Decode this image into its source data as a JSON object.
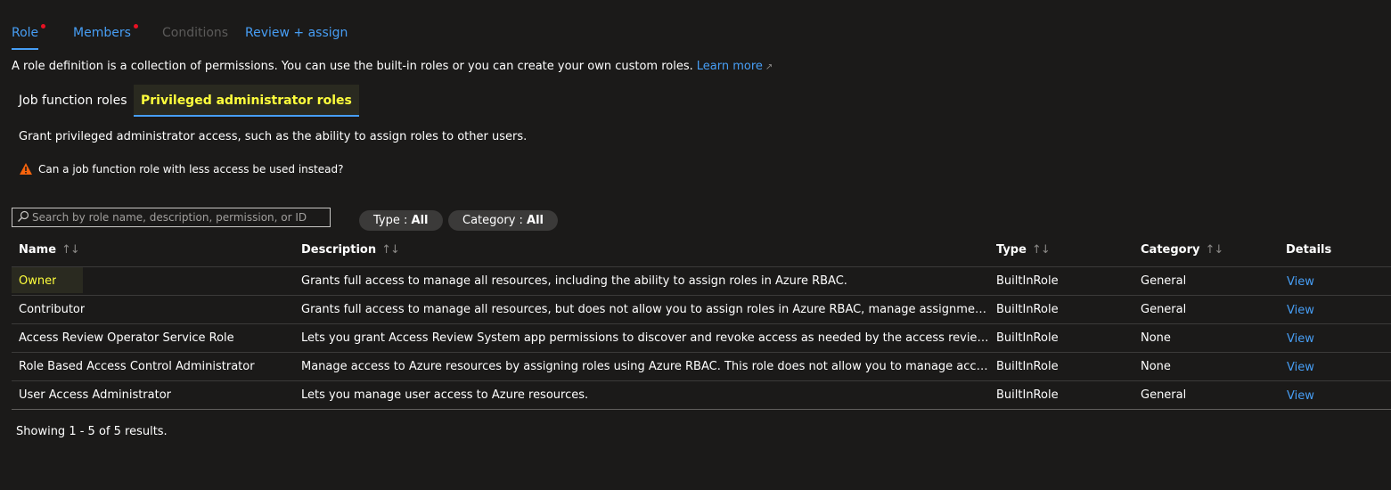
{
  "tabs": [
    {
      "label": "Role",
      "dot": true
    },
    {
      "label": "Members",
      "dot": true
    },
    {
      "label": "Conditions"
    },
    {
      "label": "Review + assign"
    }
  ],
  "intro": {
    "text": "A role definition is a collection of permissions. You can use the built-in roles or you can create your own custom roles.",
    "link": "Learn more",
    "link_icon": "external-link-icon"
  },
  "pivots": {
    "job": "Job function roles",
    "privileged": "Privileged administrator roles"
  },
  "grant_text": "Grant privileged administrator access, such as the ability to assign roles to other users.",
  "warning_text": "Can a job function role with less access be used instead?",
  "search": {
    "placeholder": "Search by role name, description, permission, or ID"
  },
  "filters": {
    "type_label": "Type : ",
    "type_value": "All",
    "category_label": "Category : ",
    "category_value": "All"
  },
  "table": {
    "headers": {
      "name": "Name",
      "description": "Description",
      "type": "Type",
      "category": "Category",
      "details": "Details"
    },
    "sort_icon": "↑↓",
    "rows": [
      {
        "name": "Owner",
        "description": "Grants full access to manage all resources, including the ability to assign roles in Azure RBAC.",
        "type": "BuiltInRole",
        "category": "General",
        "details": "View"
      },
      {
        "name": "Contributor",
        "description": "Grants full access to manage all resources, but does not allow you to assign roles in Azure RBAC, manage assignments in Azure Bluep...",
        "type": "BuiltInRole",
        "category": "General",
        "details": "View"
      },
      {
        "name": "Access Review Operator Service Role",
        "description": "Lets you grant Access Review System app permissions to discover and revoke access as needed by the access review process.",
        "type": "BuiltInRole",
        "category": "None",
        "details": "View"
      },
      {
        "name": "Role Based Access Control Administrator",
        "description": "Manage access to Azure resources by assigning roles using Azure RBAC. This role does not allow you to manage access using other ...",
        "type": "BuiltInRole",
        "category": "None",
        "details": "View"
      },
      {
        "name": "User Access Administrator",
        "description": "Lets you manage user access to Azure resources.",
        "type": "BuiltInRole",
        "category": "General",
        "details": "View"
      }
    ]
  },
  "footer": "Showing 1 - 5 of 5 results.",
  "colors": {
    "background": "#1b1a19",
    "link": "#479ef5",
    "highlight_text": "#ffff3c",
    "dot": "#e81123",
    "warning": "#f7630c"
  }
}
